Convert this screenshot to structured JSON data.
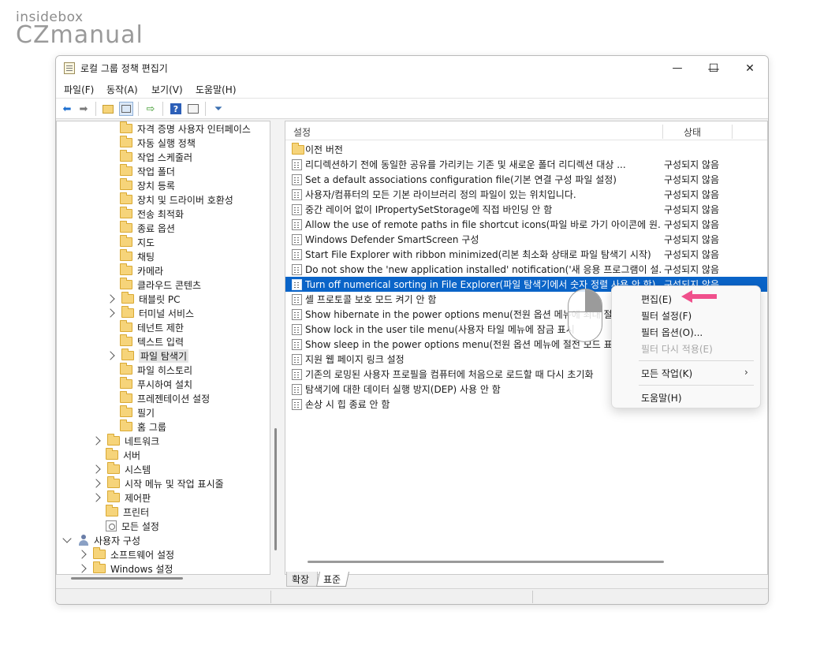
{
  "watermark": {
    "top": "insidebox",
    "bottom": "CZmanual"
  },
  "window": {
    "title": "로컬 그룹 정책 편집기"
  },
  "title_buttons": {
    "minimize": "—",
    "maximize": "☐",
    "close": "✕"
  },
  "menu": [
    "파일(F)",
    "동작(A)",
    "보기(V)",
    "도움말(H)"
  ],
  "toolbar_icons": [
    "back-arrow-icon",
    "forward-arrow-icon",
    "up-folder-icon",
    "show-tree-icon",
    "export-list-icon",
    "help-icon",
    "properties-icon",
    "filter-icon"
  ],
  "tree": [
    "자격 증명 사용자 인터페이스",
    "자동 실행 정책",
    "작업 스케줄러",
    "작업 폴더",
    "장치 등록",
    "장치 및 드라이버 호환성",
    "전송 최적화",
    "종료 옵션",
    "지도",
    "채팅",
    "카메라",
    "클라우드 콘텐츠",
    "태블릿 PC",
    "터미널 서비스",
    "테넌트 제한",
    "텍스트 입력",
    "파일 탐색기",
    "파일 히스토리",
    "푸시하여 설치",
    "프레젠테이션 설정",
    "필기",
    "홈 그룹",
    "네트워크",
    "서버",
    "시스템",
    "시작 메뉴 및 작업 표시줄",
    "제어판",
    "프린터",
    "모든 설정",
    "사용자 구성",
    "소프트웨어 설정",
    "Windows 설정"
  ],
  "columns": {
    "name": "설정",
    "state": "상태"
  },
  "rows": [
    {
      "name": "이전 버전",
      "state": ""
    },
    {
      "name": "리디렉션하기 전에 동일한 공유를 가리키는 기존 및 새로운 폴더 리디렉션 대상 ...",
      "state": "구성되지 않음"
    },
    {
      "name": "Set a default associations configuration file(기본 연결 구성 파일 설정)",
      "state": "구성되지 않음"
    },
    {
      "name": "사용자/컴퓨터의 모든 기본 라이브러리 정의 파일이 있는 위치입니다.",
      "state": "구성되지 않음"
    },
    {
      "name": "중간 레이어 없이 IPropertySetStorage에 직접 바인딩 안 함",
      "state": "구성되지 않음"
    },
    {
      "name": "Allow the use of remote paths in file shortcut icons(파일 바로 가기 아이콘에 원...",
      "state": "구성되지 않음"
    },
    {
      "name": "Windows Defender SmartScreen 구성",
      "state": "구성되지 않음"
    },
    {
      "name": "Start File Explorer with ribbon minimized(리본 최소화 상태로 파일 탐색기 시작)",
      "state": "구성되지 않음"
    },
    {
      "name": "Do not show the 'new application installed' notification('새 응용 프로그램이 설...",
      "state": "구성되지 않음"
    },
    {
      "name": "Turn off numerical sorting in File Explorer(파일 탐색기에서 숫자 정렬 사용 안 함)",
      "state": "구성되지 않음"
    },
    {
      "name": "셸 프로토콜 보호 모드 켜기 안 함",
      "state": ""
    },
    {
      "name": "Show hibernate in the power options menu(전원 옵션 메뉴에 최대 절전",
      "state": ""
    },
    {
      "name": "Show lock in the user tile menu(사용자 타일 메뉴에 잠금 표시",
      "state": ""
    },
    {
      "name": "Show sleep in the power options menu(전원 옵션 메뉴에 절전 모드 표시",
      "state": ""
    },
    {
      "name": "지원 웹 페이지 링크 설정",
      "state": ""
    },
    {
      "name": "기존의 로밍된 사용자 프로필을 컴퓨터에 처음으로 로드할 때 다시 초기화",
      "state": ""
    },
    {
      "name": "탐색기에 대한 데이터 실행 방지(DEP) 사용 안 함",
      "state": ""
    },
    {
      "name": "손상 시 힙 종료 안 함",
      "state": ""
    }
  ],
  "context_menu": {
    "edit": "편집(E)",
    "filter_on": "필터 설정(F)",
    "filter_options": "필터 옵션(O)...",
    "reapply_filter": "필터 다시 적용(E)",
    "all_tasks": "모든 작업(K)",
    "help": "도움말(H)"
  },
  "tabs": {
    "extended": "확장",
    "standard": "표준"
  },
  "colors": {
    "selection": "#0a64c8",
    "arrow": "#f0508c"
  }
}
